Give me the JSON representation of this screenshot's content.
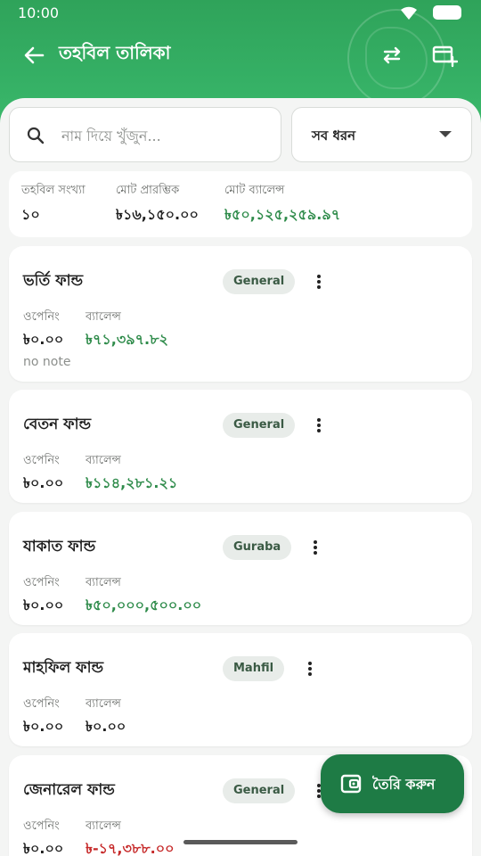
{
  "status": {
    "time": "10:00"
  },
  "appbar": {
    "title": "তহবিল তালিকা"
  },
  "search": {
    "placeholder": "নাম দিয়ে খুঁজুন..."
  },
  "filter": {
    "selected": "সব ধরন"
  },
  "summary": {
    "count_label": "তহবিল সংখ্যা",
    "count_value": "১০",
    "opening_label": "মোট প্রারম্ভিক",
    "opening_value": "৳১৬,১৫০.০০",
    "balance_label": "মোট ব্যালেন্স",
    "balance_value": "৳৫০,১২৫,২৫৯.৯৭"
  },
  "funds": [
    {
      "name": "ভর্তি ফান্ড",
      "type": "General",
      "opening_label": "ওপেনিং",
      "balance_label": "ব্যালেন্স",
      "opening": "৳০.০০",
      "balance": "৳৭১,৩৯৭.৮২",
      "note": "no note"
    },
    {
      "name": "বেতন ফান্ড",
      "type": "General",
      "opening_label": "ওপেনিং",
      "balance_label": "ব্যালেন্স",
      "opening": "৳০.০০",
      "balance": "৳১১৪,২৮১.২১"
    },
    {
      "name": "যাকাত ফান্ড",
      "type": "Guraba",
      "opening_label": "ওপেনিং",
      "balance_label": "ব্যালেন্স",
      "opening": "৳০.০০",
      "balance": "৳৫০,০০০,৫০০.০০"
    },
    {
      "name": "মাহফিল ফান্ড",
      "type": "Mahfil",
      "opening_label": "ওপেনিং",
      "balance_label": "ব্যালেন্স",
      "opening": "৳০.০০",
      "balance": "৳০.০০"
    },
    {
      "name": "জেনারেল ফান্ড",
      "type": "General",
      "opening_label": "ওপেনিং",
      "balance_label": "ব্যালেন্স",
      "opening": "৳০.০০",
      "balance": "৳-১৭,৩৮৮.০০"
    }
  ],
  "fab": {
    "label": "তৈরি করুন"
  },
  "colors": {
    "primary": "#35b065",
    "primary_dark": "#1e7b45",
    "positive": "#2e8b4a",
    "negative": "#c62828"
  }
}
